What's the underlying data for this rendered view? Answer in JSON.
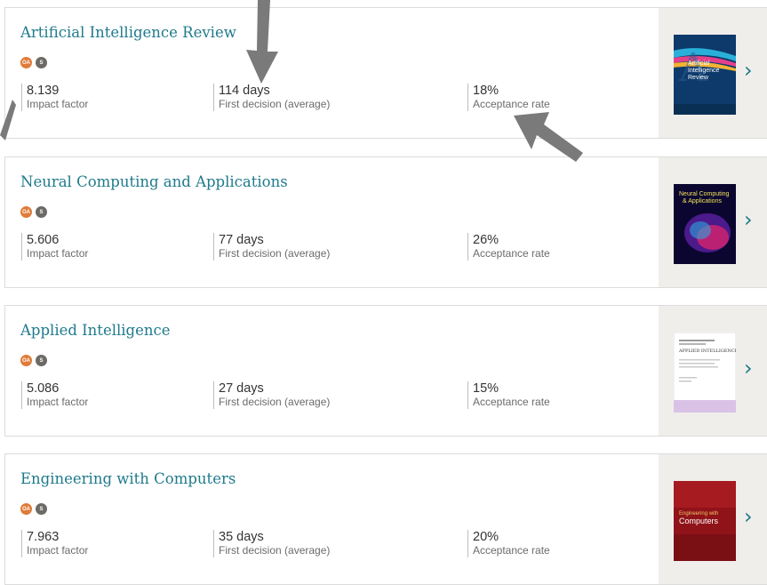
{
  "journals": [
    {
      "title": "Artificial Intelligence Review",
      "badges": [
        "OA",
        "S"
      ],
      "impact_value": "8.139",
      "impact_label": "Impact factor",
      "decision_value": "114 days",
      "decision_label": "First decision (average)",
      "acceptance_value": "18%",
      "acceptance_label": "Acceptance rate",
      "cover_title": "Artificial Intelligence Review"
    },
    {
      "title": "Neural Computing and Applications",
      "badges": [
        "OA",
        "S"
      ],
      "impact_value": "5.606",
      "impact_label": "Impact factor",
      "decision_value": "77 days",
      "decision_label": "First decision (average)",
      "acceptance_value": "26%",
      "acceptance_label": "Acceptance rate",
      "cover_title": "Neural Computing & Applications"
    },
    {
      "title": "Applied Intelligence",
      "badges": [
        "OA",
        "S"
      ],
      "impact_value": "5.086",
      "impact_label": "Impact factor",
      "decision_value": "27 days",
      "decision_label": "First decision (average)",
      "acceptance_value": "15%",
      "acceptance_label": "Acceptance rate",
      "cover_title": "APPLIED INTELLIGENCE"
    },
    {
      "title": "Engineering with Computers",
      "badges": [
        "OA",
        "S"
      ],
      "impact_value": "7.963",
      "impact_label": "Impact factor",
      "decision_value": "35 days",
      "decision_label": "First decision (average)",
      "acceptance_value": "20%",
      "acceptance_label": "Acceptance rate",
      "cover_title": "Engineering with Computers"
    }
  ],
  "icons": {
    "chevron": "chevron-right-icon",
    "annotation": "arrow-icon"
  },
  "colors": {
    "title": "#1f7a8c",
    "oa_badge": "#e07b39",
    "s_badge": "#6d6a66",
    "arrow": "#7a7a7a"
  }
}
